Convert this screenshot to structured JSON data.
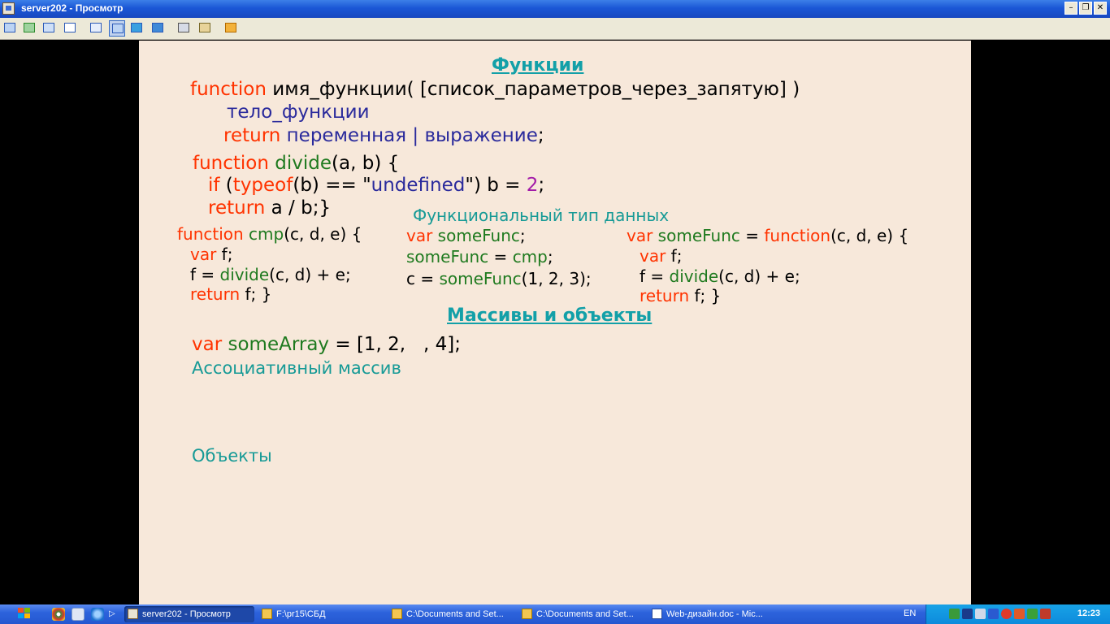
{
  "window": {
    "title": "server202 - Просмотр"
  },
  "toolbar_icons": [
    "monitor-icon",
    "refresh-icon",
    "phone-icon",
    "chat-icon",
    "window-icon",
    "fullscreen-icon",
    "screen-icon",
    "fit-icon",
    "copy-icon",
    "settings-icon",
    "stop-icon"
  ],
  "slide": {
    "heading1": "Функции",
    "syntax": {
      "kw_function": "function",
      "signature": " имя_функции( [список_параметров_через_запятую] )",
      "body": "тело_функции",
      "kw_return": "return",
      "return_expr": " переменная | выражение",
      "semicolon": ";"
    },
    "divide": {
      "kw_function": "function",
      "name": " divide",
      "params": "(a, b) {",
      "kw_if": "if",
      "paren_open": " (",
      "kw_typeof": "typeof",
      "cond": "(b) == \"",
      "str": "undefined",
      "cond2": "\") b = ",
      "num": "2",
      "semi": ";",
      "kw_return": "return",
      "ret": " a / b;}"
    },
    "cmp": {
      "kw_function": "function",
      "name": " cmp",
      "params": "(c, d, e) {",
      "kw_var": "var",
      "var_f": " f;",
      "f_assign": "f = ",
      "divide": "divide",
      "call": "(c, d) + e;",
      "kw_return": "return",
      "ret": " f; }"
    },
    "functional_type_title": "Функциональный тип данных",
    "middle": {
      "kw_var": "var",
      "var_name": " someFunc",
      "semi": ";",
      "assign_name": "someFunc",
      "assign_eq": " = ",
      "assign_val": "cmp",
      "assign_semi": ";",
      "c_assign": "c = ",
      "call_name": "someFunc",
      "call_args": "(1, 2, 3);"
    },
    "right": {
      "kw_var": "var",
      "name": " someFunc",
      "eq": " = ",
      "kw_function": "function",
      "params": "(c, d, e) {",
      "kw_var2": "var",
      "var_f": " f;",
      "f_assign": "f = ",
      "divide": "divide",
      "call": "(c, d) + e;",
      "kw_return": "return",
      "ret": " f; }"
    },
    "heading2": "Массивы и объекты",
    "array": {
      "kw_var": "var",
      "name": " someArray",
      "value": " = [1, 2,   , 4];"
    },
    "assoc_label": "Ассоциативный массив",
    "objects_label": "Объекты"
  },
  "taskbar": {
    "tasks": [
      "server202 - Просмотр",
      "F:\\pr15\\СБД",
      "C:\\Documents and Set...",
      "C:\\Documents and Set...",
      "Web-дизайн.doc - Mic..."
    ],
    "language": "EN",
    "clock": "12:23"
  }
}
